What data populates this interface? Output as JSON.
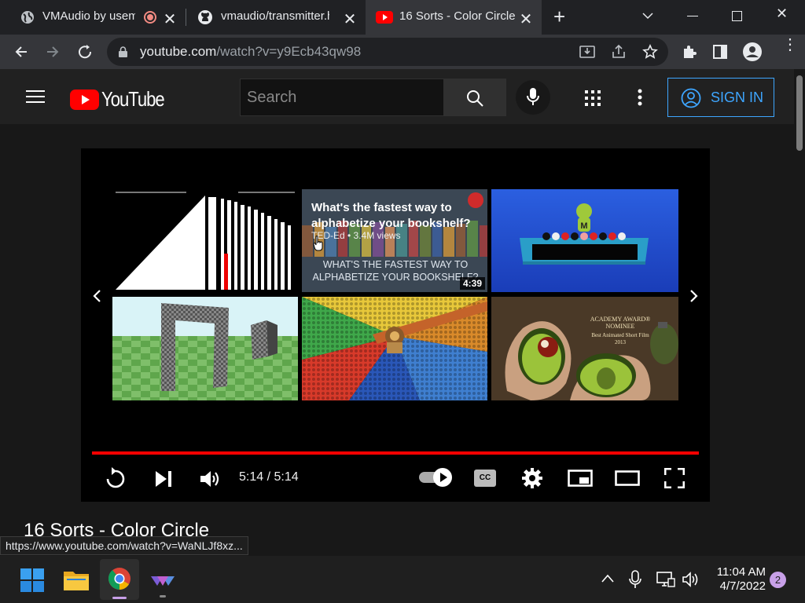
{
  "browser": {
    "tabs": [
      {
        "label": "VMAudio by usem",
        "active": false
      },
      {
        "label": "vmaudio/transmitter.h",
        "active": false
      },
      {
        "label": "16 Sorts - Color Circle",
        "active": true
      }
    ],
    "address": {
      "host": "youtube.com",
      "path": "/watch?v=y9Ecb43qw98"
    },
    "status_url": "https://www.youtube.com/watch?v=WaNLJf8xz..."
  },
  "youtube": {
    "logo_text": "YouTube",
    "search_placeholder": "Search",
    "sign_in": "SIGN IN"
  },
  "player": {
    "time": "5:14 / 5:14",
    "progress_fraction": 1.0,
    "autoplay_on": true,
    "endscreen": [
      {
        "kind": "sort-bars"
      },
      {
        "kind": "ted",
        "title": "What's the fastest way to alphabetize your bookshelf?",
        "channel_views": "TED-Ed • 3.4M views",
        "caption": "WHAT'S THE FASTEST WAY TO ALPHABETIZE YOUR BOOKSHELF?",
        "duration": "4:39"
      },
      {
        "kind": "balls"
      },
      {
        "kind": "portal"
      },
      {
        "kind": "color-wheel"
      },
      {
        "kind": "avocado",
        "award": "ACADEMY AWARD® NOMINEE",
        "award_sub": "Best Animated Short Film",
        "award_year": "2013"
      }
    ]
  },
  "video": {
    "title": "16 Sorts - Color Circle"
  },
  "taskbar": {
    "time": "11:04 AM",
    "date": "4/7/2022",
    "notifications": "2"
  },
  "colors": {
    "accent": "#3ea6ff",
    "progress": "#ff0000",
    "tabbar": "#202124",
    "yt_bg": "#181818"
  }
}
